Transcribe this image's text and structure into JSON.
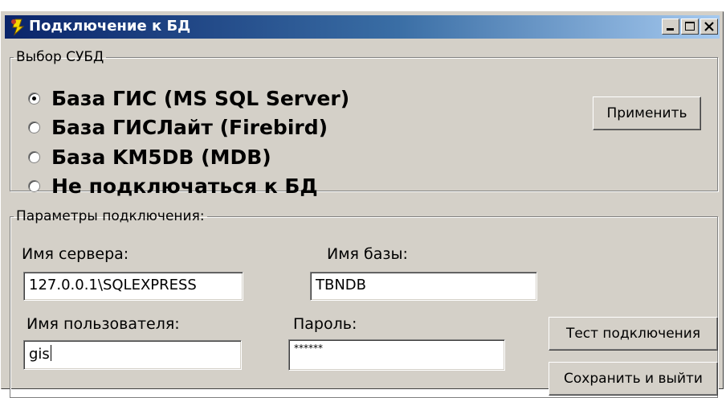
{
  "window": {
    "title": "Подключение к БД",
    "icon": "db-connection-icon",
    "controls": {
      "minimize_icon": "minimize-icon",
      "maximize_icon": "maximize-icon",
      "close_icon": "close-icon"
    }
  },
  "dbms_group": {
    "legend": "Выбор СУБД",
    "options": [
      {
        "label": "База ГИС (MS SQL Server)",
        "checked": true
      },
      {
        "label": "База ГИСЛайт (Firebird)",
        "checked": false
      },
      {
        "label": "База KM5DB (MDB)",
        "checked": false
      },
      {
        "label": "Не подключаться к БД",
        "checked": false
      }
    ],
    "apply_label": "Применить"
  },
  "params_group": {
    "legend": "Параметры подключения:",
    "server_label": "Имя сервера:",
    "server_value": "127.0.0.1\\SQLEXPRESS",
    "db_label": "Имя базы:",
    "db_value": "TBNDB",
    "user_label": "Имя пользователя:",
    "user_value": "gis",
    "password_label": "Пароль:",
    "password_value": "******",
    "test_label": "Тест подключения",
    "save_label": "Сохранить и выйти"
  },
  "colors": {
    "face": "#d4d0c8",
    "title_start": "#0a246a",
    "title_end": "#a6caf0"
  }
}
